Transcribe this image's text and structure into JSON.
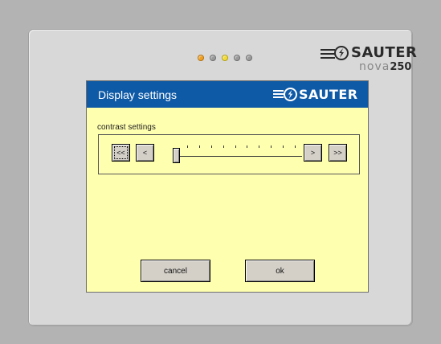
{
  "brand": {
    "name": "SAUTER",
    "product_prefix": "nova",
    "product_number": "250"
  },
  "status_leds": [
    "orange",
    "gray",
    "yellow",
    "gray",
    "gray"
  ],
  "dialog": {
    "title": "Display settings",
    "brand_name": "SAUTER",
    "section_label": "contrast settings",
    "buttons": {
      "fast_decrease": "<<",
      "decrease": "<",
      "increase": ">",
      "fast_increase": ">>",
      "cancel": "cancel",
      "ok": "ok"
    },
    "contrast_level": 0.0,
    "tick_count": 10
  },
  "colors": {
    "titlebar": "#0f5aa6",
    "screen_background": "#ffffb0",
    "led_orange": "#f0a020",
    "led_yellow": "#f3dc3a"
  }
}
